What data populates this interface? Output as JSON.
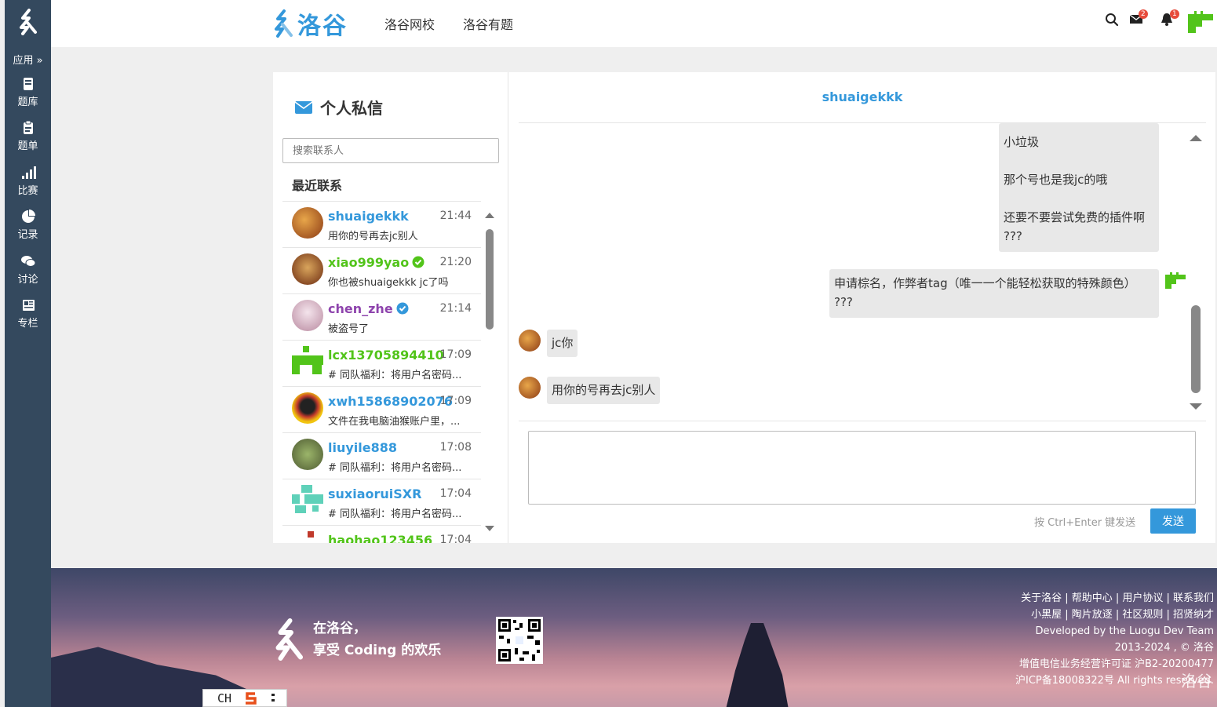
{
  "sidebar": {
    "apps_label": "应用 »",
    "items": [
      {
        "label": "题库",
        "icon": "book-icon"
      },
      {
        "label": "题单",
        "icon": "clipboard-icon"
      },
      {
        "label": "比赛",
        "icon": "signal-bars-icon"
      },
      {
        "label": "记录",
        "icon": "pie-chart-icon"
      },
      {
        "label": "讨论",
        "icon": "comments-icon"
      },
      {
        "label": "专栏",
        "icon": "newspaper-icon"
      }
    ]
  },
  "header": {
    "brand": "洛谷",
    "nav": [
      "洛谷网校",
      "洛谷有题"
    ],
    "mail_badge": "2",
    "bell_badge": "1"
  },
  "pm": {
    "title": "个人私信",
    "search_placeholder": "搜索联系人",
    "recent_label": "最近联系",
    "contacts": [
      {
        "name": "shuaigekkk",
        "time": "21:44",
        "preview": "用你的号再去jc别人",
        "color": "#3498db"
      },
      {
        "name": "xiao999yao",
        "time": "21:20",
        "preview": "你也被shuaigekkk jc了吗",
        "color": "#52c41a"
      },
      {
        "name": "chen_zhe",
        "time": "21:14",
        "preview": "被盗号了",
        "color": "#8e44ad"
      },
      {
        "name": "lcx13705894410",
        "time": "17:09",
        "preview": "# 同队福利：将用户名密码...",
        "color": "#52c41a"
      },
      {
        "name": "xwh15868902076",
        "time": "17:09",
        "preview": "文件在我电脑油猴账户里，...",
        "color": "#3498db"
      },
      {
        "name": "liuyile888",
        "time": "17:08",
        "preview": "# 同队福利：将用户名密码...",
        "color": "#3498db"
      },
      {
        "name": "suxiaoruiSXR",
        "time": "17:04",
        "preview": "# 同队福利：将用户名密码...",
        "color": "#3498db"
      },
      {
        "name": "haohao123456",
        "time": "17:04",
        "preview": "",
        "color": "#52c41a"
      }
    ]
  },
  "chat": {
    "title": "shuaigekkk",
    "messages": [
      {
        "side": "right",
        "lines": [
          "小垃圾",
          "",
          "那个号也是我jc的哦",
          "",
          "还要不要尝试免费的插件啊",
          "???"
        ]
      },
      {
        "side": "right",
        "lines": [
          "申请棕名，作弊者tag（唯一一个能轻松获取的特殊颜色）",
          "???"
        ]
      },
      {
        "side": "left",
        "lines": [
          "jc你"
        ]
      },
      {
        "side": "left",
        "lines": [
          "用你的号再去jc别人"
        ]
      }
    ],
    "hint": "按 Ctrl+Enter 键发送",
    "send_label": "发送"
  },
  "footer": {
    "slogan_line1": "在洛谷，",
    "slogan_line2": "享受 Coding 的欢乐",
    "links_row1": "关于洛谷 | 帮助中心 | 用户协议 | 联系我们",
    "links_row2": "小黑屋 | 陶片放逐 | 社区规则 | 招贤纳才",
    "dev_prefix": "Developed by the",
    "dev_team": "Luogu Dev Team",
    "copyright": "2013-2024 , © 洛谷",
    "license": "增值电信业务经营许可证 沪B2-20200477",
    "icp": "沪ICP备18008322号 All rights reserved.",
    "watermark": "洛谷"
  },
  "ime": {
    "label": "CH"
  }
}
